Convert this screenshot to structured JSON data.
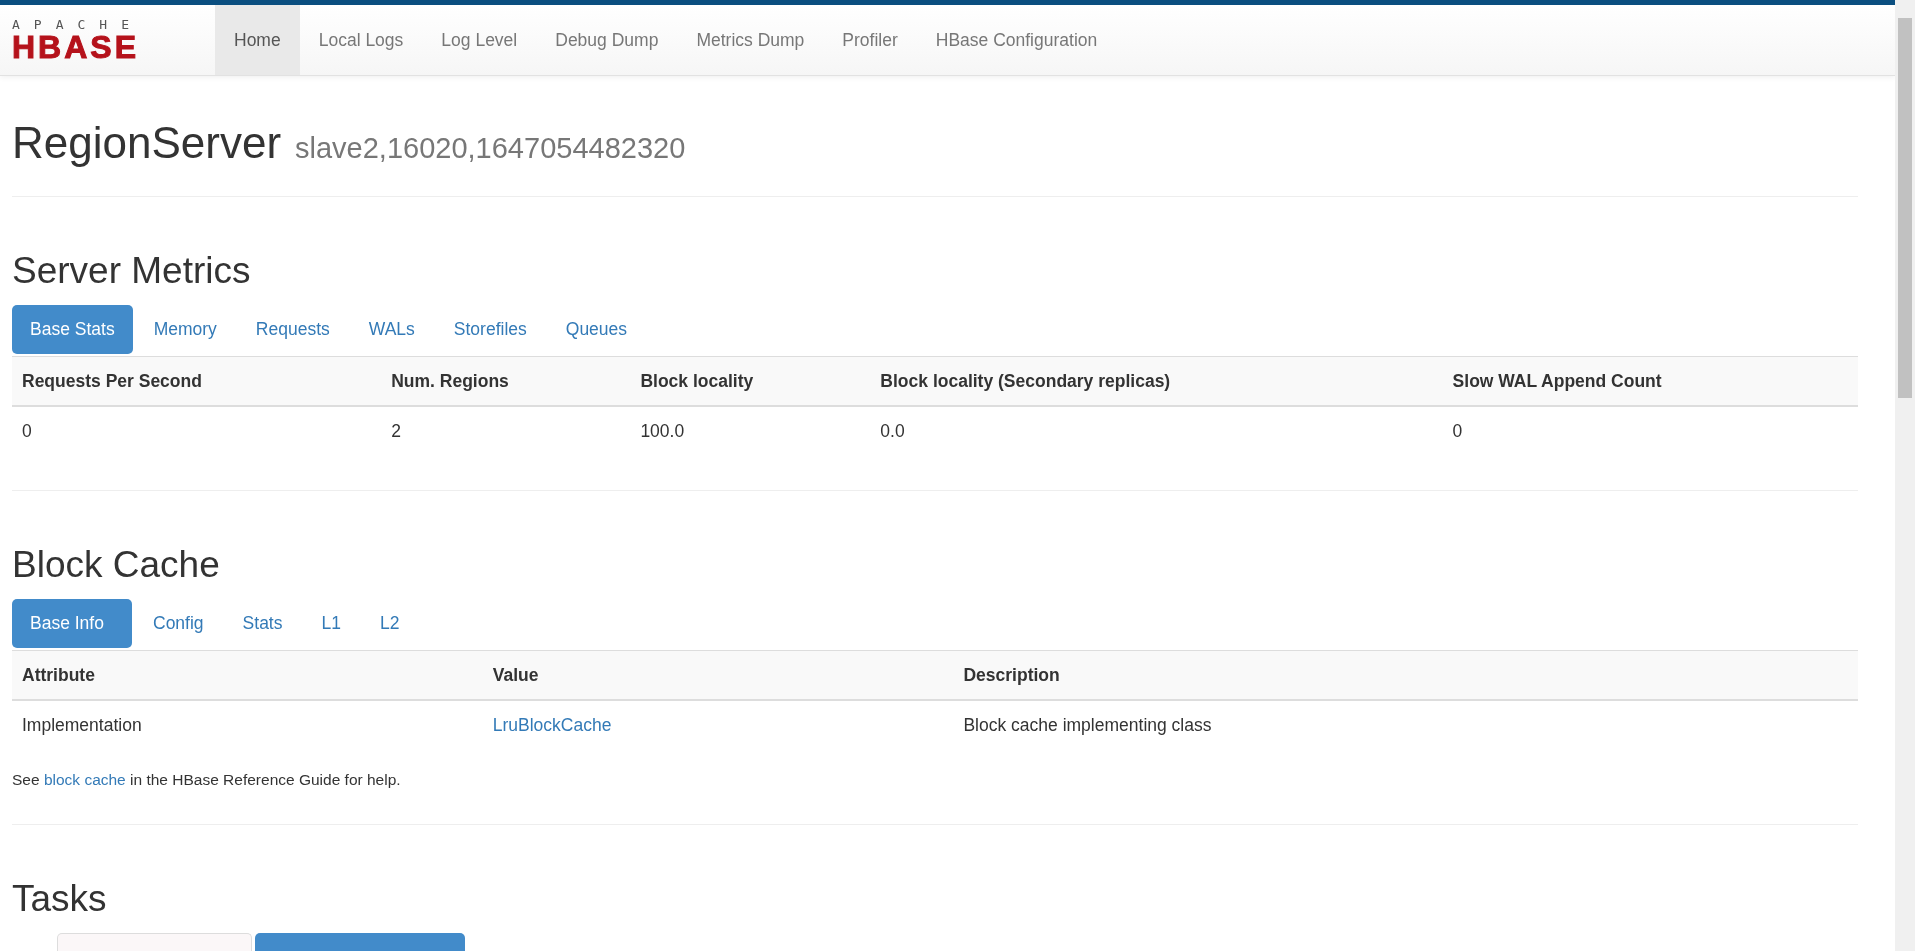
{
  "navbar": {
    "logo": {
      "top": "APACHE",
      "bottom": "HBASE"
    },
    "items": [
      {
        "label": "Home",
        "selected": true
      },
      {
        "label": "Local Logs",
        "selected": false
      },
      {
        "label": "Log Level",
        "selected": false
      },
      {
        "label": "Debug Dump",
        "selected": false
      },
      {
        "label": "Metrics Dump",
        "selected": false
      },
      {
        "label": "Profiler",
        "selected": false
      },
      {
        "label": "HBase Configuration",
        "selected": false
      }
    ]
  },
  "page_header": {
    "title": "RegionServer",
    "subtitle": "slave2,16020,1647054482320"
  },
  "sections": [
    {
      "title": "Server Metrics",
      "tabs": [
        {
          "label": "Base Stats",
          "selected": true
        },
        {
          "label": "Memory",
          "selected": false
        },
        {
          "label": "Requests",
          "selected": false
        },
        {
          "label": "WALs",
          "selected": false
        },
        {
          "label": "Storefiles",
          "selected": false
        },
        {
          "label": "Queues",
          "selected": false
        }
      ],
      "table": {
        "columns": [
          "Requests Per Second",
          "Num. Regions",
          "Block locality",
          "Block locality (Secondary replicas)",
          "Slow WAL Append Count"
        ],
        "rows": [
          [
            {
              "text": "0"
            },
            {
              "text": "2"
            },
            {
              "text": "100.0"
            },
            {
              "text": "0.0"
            },
            {
              "text": "0"
            }
          ]
        ]
      }
    },
    {
      "title": "Block Cache",
      "tabs": [
        {
          "label": "Base Info",
          "selected": true
        },
        {
          "label": "Config",
          "selected": false
        },
        {
          "label": "Stats",
          "selected": false
        },
        {
          "label": "L1",
          "selected": false
        },
        {
          "label": "L2",
          "selected": false
        }
      ],
      "table": {
        "columns": [
          "Attribute",
          "Value",
          "Description"
        ],
        "rows": [
          [
            {
              "text": "Implementation"
            },
            {
              "text": "LruBlockCache",
              "link": true
            },
            {
              "text": "Block cache implementing class"
            }
          ]
        ]
      },
      "note": {
        "before": "See ",
        "link": "block cache",
        "after": " in the HBase Reference Guide for help."
      }
    },
    {
      "title": "Tasks",
      "tabs": [
        {
          "selected": false
        },
        {
          "selected": true
        }
      ]
    }
  ]
}
